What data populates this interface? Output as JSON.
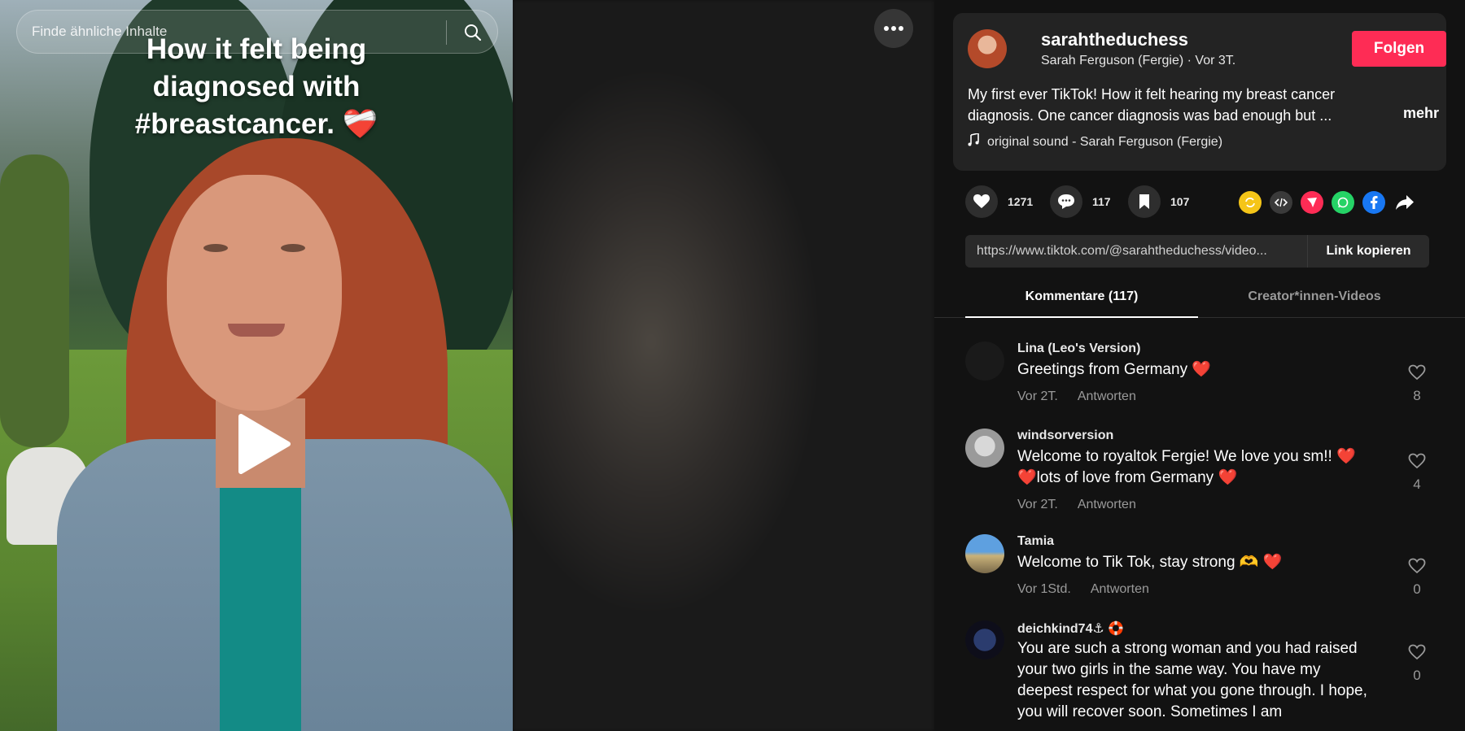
{
  "search": {
    "placeholder": "Finde ähnliche Inhalte"
  },
  "video": {
    "caption": "How it felt being diagnosed with #breastcancer. ❤️‍🩹"
  },
  "author": {
    "username": "sarahtheduchess",
    "display_name": "Sarah Ferguson (Fergie)",
    "posted": "Vor 3T.",
    "follow_label": "Folgen",
    "description": "My first ever TikTok! How it felt hearing my breast cancer diagnosis. One cancer diagnosis was bad enough but ...",
    "more_label": "mehr",
    "sound": "original sound - Sarah Ferguson (Fergie)"
  },
  "stats": {
    "likes": "1271",
    "comments": "117",
    "saves": "107"
  },
  "share": {
    "url": "https://www.tiktok.com/@sarahtheduchess/video...",
    "copy_label": "Link kopieren"
  },
  "tabs": {
    "comments": "Kommentare (117)",
    "creator": "Creator*innen-Videos"
  },
  "comments": [
    {
      "user": "Lina (Leo's Version)",
      "text": "Greetings from Germany ❤️",
      "time": "Vor 2T.",
      "reply": "Antworten",
      "likes": "8"
    },
    {
      "user": "windsorversion",
      "text": "Welcome to royaltok Fergie! We love you sm!! ❤️ ❤️lots of love from Germany ❤️",
      "time": "Vor 2T.",
      "reply": "Antworten",
      "likes": "4"
    },
    {
      "user": "Tamia",
      "text": "Welcome to Tik Tok, stay strong 🫶 ❤️",
      "time": "Vor 1Std.",
      "reply": "Antworten",
      "likes": "0"
    },
    {
      "user": "deichkind74⚓ 🛟",
      "text": "You are such a strong woman and you had raised your two girls in the same way. You have my deepest respect for what you gone through. I hope, you will recover soon. Sometimes I am",
      "likes": "0"
    }
  ],
  "colors": {
    "accent": "#fe2c55",
    "panel_bg": "#121212",
    "card_bg": "#232323"
  }
}
